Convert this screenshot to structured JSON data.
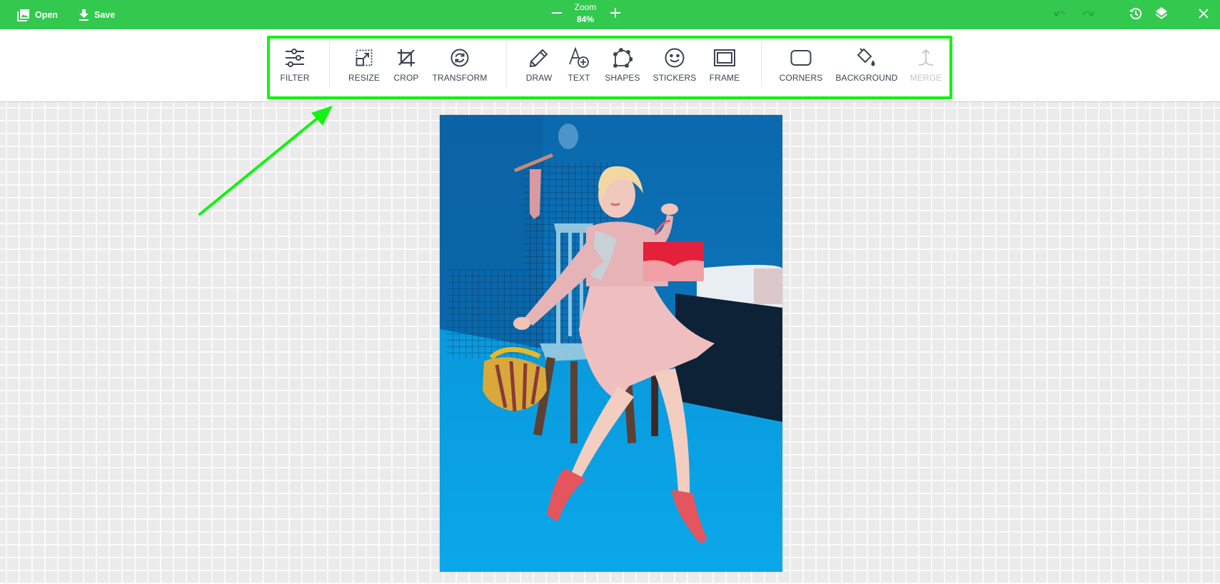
{
  "topbar": {
    "open_label": "Open",
    "save_label": "Save",
    "zoom_title": "Zoom",
    "zoom_value": "84%",
    "icons": {
      "open": "image-gallery-icon",
      "save": "download-icon",
      "zoom_out": "minus-icon",
      "zoom_in": "plus-icon",
      "undo": "undo-icon",
      "redo": "redo-icon",
      "history": "history-icon",
      "layers": "layers-icon",
      "close": "close-icon"
    },
    "undo_enabled": false,
    "redo_enabled": false,
    "background_color": "#33c94f"
  },
  "toolbar": {
    "highlight_color": "#12f312",
    "groups": [
      [
        {
          "id": "filter",
          "label": "FILTER",
          "icon": "sliders-icon",
          "enabled": true
        }
      ],
      [
        {
          "id": "resize",
          "label": "RESIZE",
          "icon": "resize-icon",
          "enabled": true
        },
        {
          "id": "crop",
          "label": "CROP",
          "icon": "crop-icon",
          "enabled": true
        },
        {
          "id": "transform",
          "label": "TRANSFORM",
          "icon": "rotate-icon",
          "enabled": true
        }
      ],
      [
        {
          "id": "draw",
          "label": "DRAW",
          "icon": "pencil-icon",
          "enabled": true
        },
        {
          "id": "text",
          "label": "TEXT",
          "icon": "add-text-icon",
          "enabled": true
        },
        {
          "id": "shapes",
          "label": "SHAPES",
          "icon": "polygon-icon",
          "enabled": true
        },
        {
          "id": "stickers",
          "label": "STICKERS",
          "icon": "smiley-icon",
          "enabled": true
        },
        {
          "id": "frame",
          "label": "FRAME",
          "icon": "frame-icon",
          "enabled": true
        }
      ],
      [
        {
          "id": "corners",
          "label": "CORNERS",
          "icon": "rounded-rect-icon",
          "enabled": true
        },
        {
          "id": "background",
          "label": "BACKGROUND",
          "icon": "paint-bucket-icon",
          "enabled": true
        },
        {
          "id": "merge",
          "label": "MERGE",
          "icon": "merge-icon",
          "enabled": false
        }
      ]
    ]
  },
  "canvas": {
    "image_description": "Fashion photo: blonde woman in pink blouse and skirt seated on light-blue chair in a blue studio, holding red handbag, yellow patchwork bag, red heels, white bathtub at right",
    "annotation_arrow_color": "#12f312"
  }
}
